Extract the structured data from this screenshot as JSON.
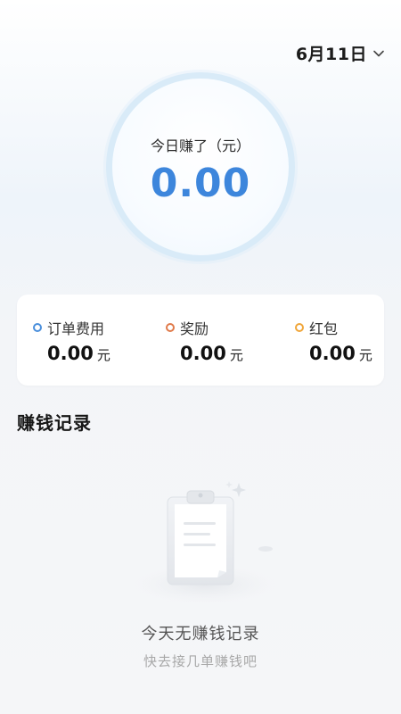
{
  "header": {
    "date": "6月11日"
  },
  "earnings": {
    "label": "今日赚了（元）",
    "amount": "0.00"
  },
  "summary": {
    "items": [
      {
        "label": "订单费用",
        "value": "0.00",
        "unit": "元",
        "dot_color": "#4a8fdc"
      },
      {
        "label": "奖励",
        "value": "0.00",
        "unit": "元",
        "dot_color": "#e07a4a"
      },
      {
        "label": "红包",
        "value": "0.00",
        "unit": "元",
        "dot_color": "#f0a63a"
      }
    ]
  },
  "records": {
    "title": "赚钱记录",
    "empty_title": "今天无赚钱记录",
    "empty_subtitle": "快去接几单赚钱吧"
  },
  "colors": {
    "accent": "#3d86dc",
    "ring": "#d9ebf8"
  }
}
